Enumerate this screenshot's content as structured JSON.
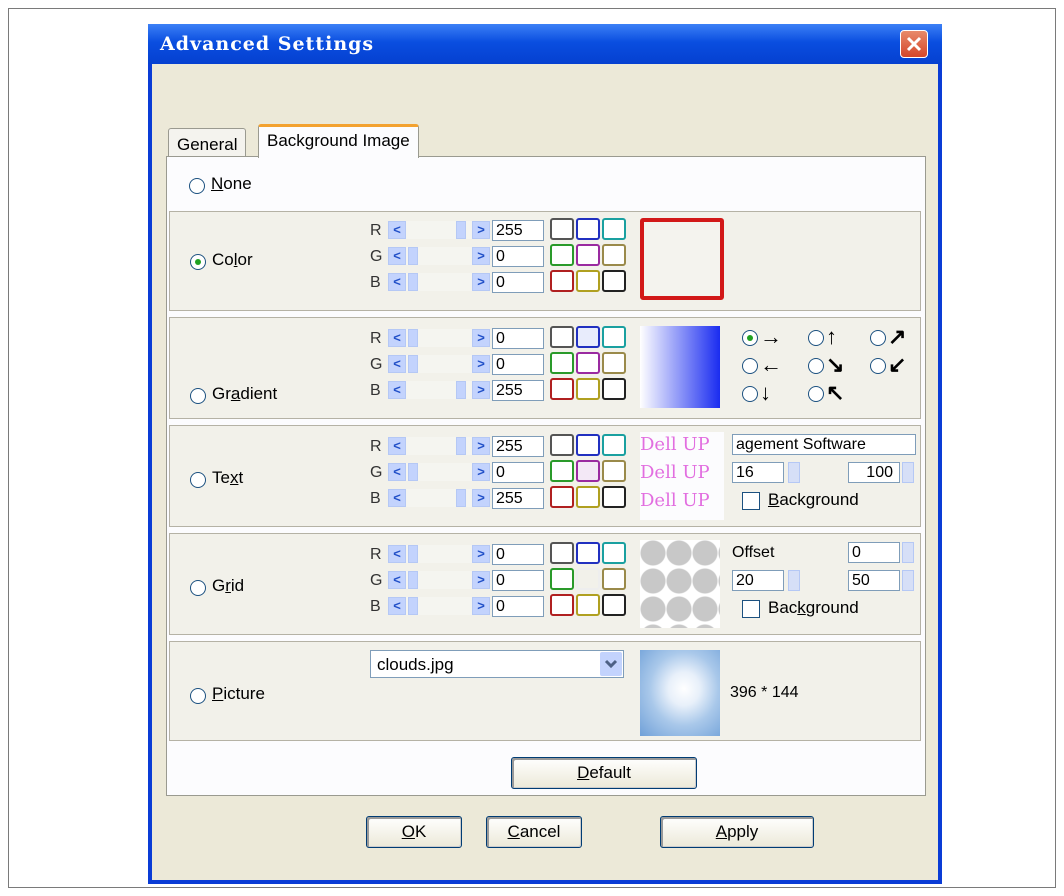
{
  "window": {
    "title": "Advanced Settings"
  },
  "tabs": [
    {
      "label": "General"
    },
    {
      "label": "Background Image"
    }
  ],
  "none": {
    "label_u": "N",
    "label_rest": "one"
  },
  "color": {
    "label_pre": "Co",
    "label_u": "l",
    "label_post": "or",
    "r": "255",
    "g": "0",
    "b": "0"
  },
  "gradient": {
    "label_pre": "Gr",
    "label_u": "a",
    "label_post": "dient",
    "r": "0",
    "g": "0",
    "b": "255",
    "directions": [
      "→",
      "↑",
      "↗",
      "←",
      "↘",
      "↙",
      "↓",
      "↖"
    ]
  },
  "text": {
    "label_pre": "Te",
    "label_u": "x",
    "label_post": "t",
    "r": "255",
    "g": "0",
    "b": "255",
    "preview": [
      "Dell UP",
      "Dell UP",
      "Dell UP"
    ],
    "text_value": "agement Software",
    "size_value": "16",
    "percent_value": "100",
    "background_u": "B",
    "background_rest": "ackground"
  },
  "grid": {
    "label_pre": "G",
    "label_u": "r",
    "label_post": "id",
    "r": "0",
    "g": "0",
    "b": "0",
    "offset_label": "Offset",
    "offset_value": "0",
    "size_value": "20",
    "percent_value": "50",
    "background_pre": "Bac",
    "background_u": "k",
    "background_post": "ground"
  },
  "picture": {
    "label_u": "P",
    "label_rest": "icture",
    "file": "clouds.jpg",
    "dimensions": "396 * 144"
  },
  "rgb_labels": {
    "r": "R",
    "g": "G",
    "b": "B"
  },
  "buttons": {
    "default_u": "D",
    "default_rest": "efault",
    "ok_u": "O",
    "ok_rest": "K",
    "cancel_u": "C",
    "cancel_rest": "ancel",
    "apply_u": "A",
    "apply_rest": "pply"
  },
  "colors": {
    "titlebar": "#0a4ee0",
    "close": "#d4462a",
    "selection": "#21a121",
    "tab_accent": "#f3a230"
  }
}
